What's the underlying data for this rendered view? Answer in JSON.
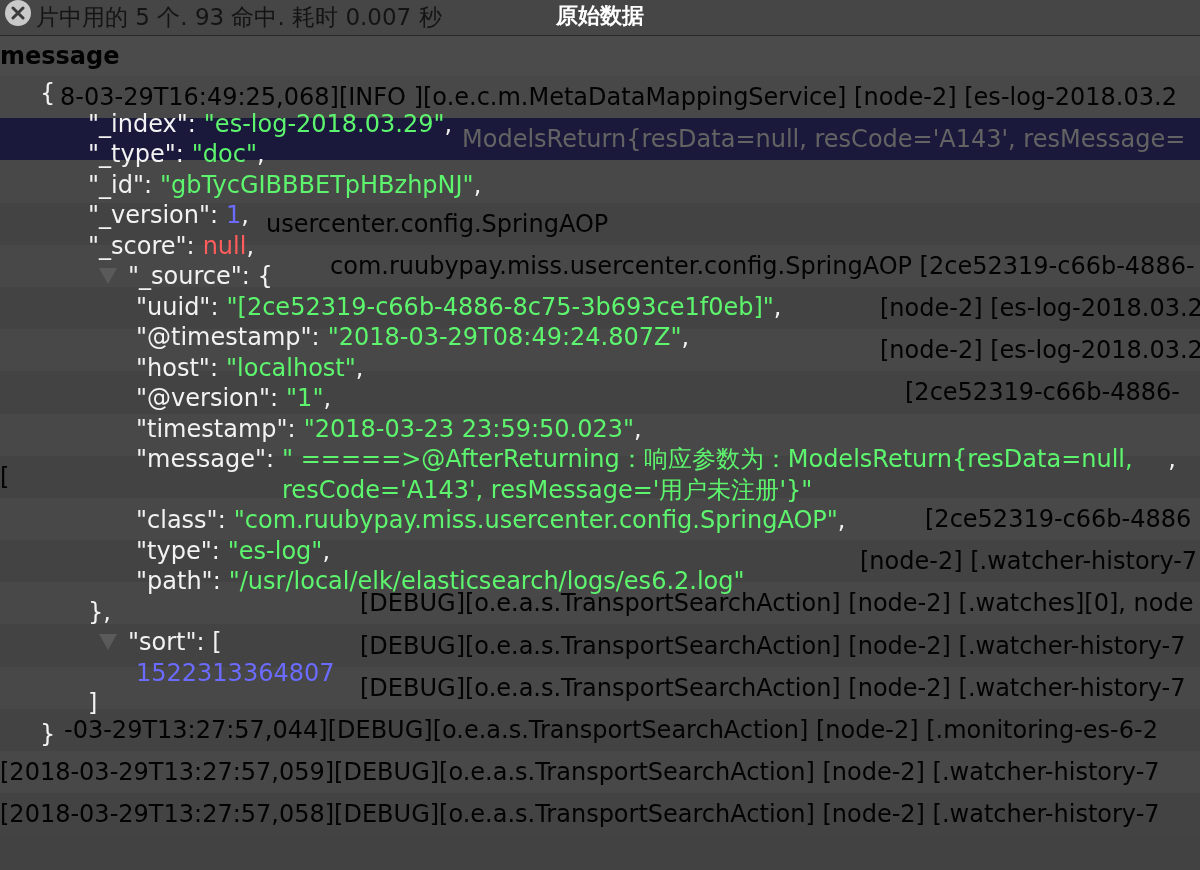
{
  "background": {
    "summary": "片中用的 5 个. 93 命中. 耗时 0.007 秒",
    "column_header": "message",
    "rows": [
      {
        "text": "8-03-29T16:49:25,068][INFO ][o.e.c.m.MetaDataMappingService] [node-2] [es-log-2018.03.2",
        "selected": false
      },
      {
        "text": "ModelsReturn{resData=null, resCode='A143', resMessage=",
        "selected": true
      },
      {
        "selected": false
      },
      {
        "text": "usercenter.config.SpringAOP",
        "selected": false
      },
      {
        "text": "com.ruubypay.miss.usercenter.config.SpringAOP [2ce52319-c66b-4886-",
        "selected": false
      },
      {
        "text": "[node-2] [es-log-2018.03.2",
        "selected": false
      },
      {
        "text": "[node-2] [es-log-2018.03.2",
        "selected": false
      },
      {
        "text": "[2ce52319-c66b-4886-",
        "selected": false
      },
      {
        "selected": false
      },
      {
        "text": "[",
        "selected": false
      },
      {
        "text": "[2ce52319-c66b-4886",
        "selected": false
      },
      {
        "text": "[node-2] [.watcher-history-7",
        "selected": false
      },
      {
        "text": "[DEBUG][o.e.a.s.TransportSearchAction] [node-2] [.watches][0], node",
        "selected": false
      },
      {
        "text": "[DEBUG][o.e.a.s.TransportSearchAction] [node-2] [.watcher-history-7",
        "selected": false
      },
      {
        "text": "[DEBUG][o.e.a.s.TransportSearchAction] [node-2] [.watcher-history-7",
        "selected": false
      },
      {
        "text": "-03-29T13:27:57,044][DEBUG][o.e.a.s.TransportSearchAction] [node-2] [.monitoring-es-6-2",
        "selected": false
      },
      {
        "text": "[2018-03-29T13:27:57,059][DEBUG][o.e.a.s.TransportSearchAction] [node-2] [.watcher-history-7",
        "selected": false
      },
      {
        "text": "[2018-03-29T13:27:57,058][DEBUG][o.e.a.s.TransportSearchAction] [node-2] [.watcher-history-7",
        "selected": false
      }
    ]
  },
  "dialog": {
    "title": "原始数据",
    "document": {
      "open": "{",
      "close": "}",
      "children": [
        {
          "kind": "string",
          "key": "\"_index\":",
          "value": "\"es-log-2018.03.29\"",
          "comma": ","
        },
        {
          "kind": "string",
          "key": "\"_type\":",
          "value": "\"doc\"",
          "comma": ","
        },
        {
          "kind": "string",
          "key": "\"_id\":",
          "value": "\"gbTycGIBBBETpHBzhpNJ\"",
          "comma": ","
        },
        {
          "kind": "number",
          "key": "\"_version\":",
          "value": "1",
          "comma": ","
        },
        {
          "kind": "null",
          "key": "\"_score\":",
          "value": "null",
          "comma": ","
        },
        {
          "kind": "object",
          "key": "\"_source\":",
          "open": "{",
          "close": "},",
          "expanded": true,
          "children": [
            {
              "kind": "string",
              "key": "\"uuid\":",
              "value": "\"[2ce52319-c66b-4886-8c75-3b693ce1f0eb]\"",
              "comma": ","
            },
            {
              "kind": "string",
              "key": "\"@timestamp\":",
              "value": "\"2018-03-29T08:49:24.807Z\"",
              "comma": ","
            },
            {
              "kind": "string",
              "key": "\"host\":",
              "value": "\"localhost\"",
              "comma": ","
            },
            {
              "kind": "string",
              "key": "\"@version\":",
              "value": "\"1\"",
              "comma": ","
            },
            {
              "kind": "string",
              "key": "\"timestamp\":",
              "value": "\"2018-03-23 23:59:50.023\"",
              "comma": ","
            },
            {
              "kind": "string",
              "key": "\"message\":",
              "value": "\" =====>@AfterReturning：响应参数为：ModelsReturn{resData=null, resCode='A143', resMessage='用户未注册'}\"",
              "comma": ","
            },
            {
              "kind": "string",
              "key": "\"class\":",
              "value": "\"com.ruubypay.miss.usercenter.config.SpringAOP\"",
              "comma": ","
            },
            {
              "kind": "string",
              "key": "\"type\":",
              "value": "\"es-log\"",
              "comma": ","
            },
            {
              "kind": "string",
              "key": "\"path\":",
              "value": "\"/usr/local/elk/elasticsearch/logs/es6.2.log\""
            }
          ]
        },
        {
          "kind": "array",
          "key": "\"sort\":",
          "open": "[",
          "close": "]",
          "expanded": true,
          "children": [
            {
              "kind": "number",
              "value": "1522313364807"
            }
          ]
        }
      ]
    }
  }
}
